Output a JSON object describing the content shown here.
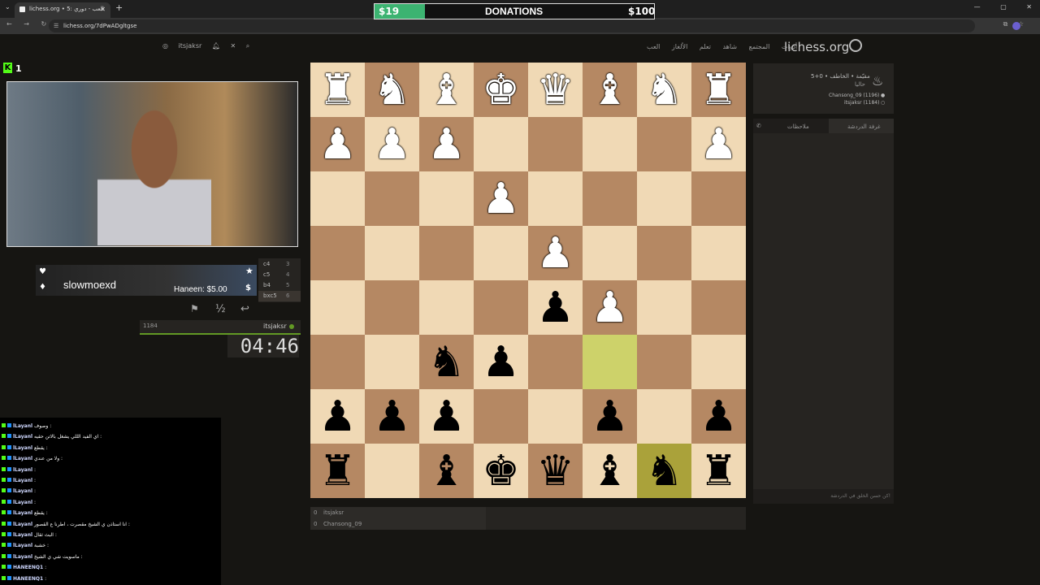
{
  "browser": {
    "tab_title": "lichess.org • العب - دوري :5",
    "url": "lichess.org/7dPwADgltgse",
    "tab_close": "✕",
    "new_tab": "+",
    "tab_list": "⌄",
    "window_controls": [
      "—",
      "▢",
      "✕"
    ],
    "nav": [
      "←",
      "→",
      "↻"
    ],
    "addr_icons": [
      "⧉",
      "☆"
    ],
    "site_icon": "☰"
  },
  "donations": {
    "low": "$19",
    "title": "DONATIONS",
    "high": "$100",
    "progress": 0.19
  },
  "header": {
    "logo": "lichess.org",
    "nav": [
      "أدوات",
      "المجتمع",
      "شاهد",
      "تعلم",
      "الألغاز",
      "العب"
    ],
    "username": "itsjaksr",
    "icons": [
      "user-icon",
      "bell-icon",
      "close-icon",
      "search-icon"
    ]
  },
  "stream": {
    "platform_badge": "K",
    "viewer_count": "1",
    "streamer_name": "slowmoexd",
    "latest_donation": "Haneen: $5.00",
    "heart": "♥",
    "drop": "♦",
    "star": "★",
    "dollar": "$"
  },
  "move_list": [
    {
      "move": "c4",
      "num": "3"
    },
    {
      "move": "c5",
      "num": "4"
    },
    {
      "move": "b4",
      "num": "5"
    },
    {
      "move": "bxc5",
      "num": "6"
    }
  ],
  "game_controls": {
    "resign": "⚑",
    "draw": "½",
    "takeback": "↩"
  },
  "self_player": {
    "rating": "1184",
    "name": "itsjaksr",
    "clock": "04:46"
  },
  "chat": [
    {
      "user": "lLayanl",
      "msg": "وصوف :"
    },
    {
      "user": "lLayanl",
      "msg": "اي الفيد الللي يشغل بالاتن حقيه :"
    },
    {
      "user": "lLayanl",
      "msg": "يقطع :"
    },
    {
      "user": "lLayanl",
      "msg": "ولا من عندي :"
    },
    {
      "user": "lLayanl",
      "msg": ":"
    },
    {
      "user": "lLayanl",
      "msg": ":"
    },
    {
      "user": "lLayanl",
      "msg": ":"
    },
    {
      "user": "lLayanl",
      "msg": ":"
    },
    {
      "user": "lLayanl",
      "msg": "يقطع :"
    },
    {
      "user": "lLayanl",
      "msg": "انا استاذن ي الشيخ مقصرت ، اطرنا ع القصور :"
    },
    {
      "user": "lLayanl",
      "msg": "البث ثقال :"
    },
    {
      "user": "lLayanl",
      "msg": "خشبة :"
    },
    {
      "user": "lLayanl",
      "msg": "ماسويت شي ي الشيخ :"
    },
    {
      "user": "HANEENQ1",
      "msg": ":"
    },
    {
      "user": "HANEENQ1",
      "msg": ":"
    }
  ],
  "board": {
    "light_color": "#f0d9b5",
    "dark_color": "#b58863",
    "highlight_light": "#cdd26a",
    "highlight_dark": "#aaa23a",
    "rows": [
      [
        "wR",
        "wN",
        "wB",
        "wK",
        "wQ",
        "wB",
        "wN",
        "wR"
      ],
      [
        "wP",
        "wP",
        "wP",
        "",
        "",
        "",
        "",
        "wP"
      ],
      [
        "",
        "",
        "",
        "wP",
        "",
        "",
        "",
        ""
      ],
      [
        "",
        "",
        "",
        "",
        "wP",
        "",
        "",
        ""
      ],
      [
        "",
        "",
        "",
        "",
        "bP",
        "wP",
        "",
        ""
      ],
      [
        "",
        "",
        "bN",
        "bP",
        "",
        "",
        "",
        ""
      ],
      [
        "bP",
        "bP",
        "bP",
        "",
        "",
        "bP",
        "",
        "bP"
      ],
      [
        "bR",
        "",
        "bB",
        "bK",
        "bQ",
        "bB",
        "bN",
        "bR"
      ]
    ],
    "highlights": [
      [
        5,
        5
      ],
      [
        7,
        6
      ]
    ]
  },
  "players": [
    {
      "score": "0",
      "name": "itsjaksr"
    },
    {
      "score": "0",
      "name": "Chansong_09"
    }
  ],
  "game_info": {
    "mode": "5+0 • مقيّمة • الخاطف",
    "time": "حاليا",
    "white": "Chansong_09 (1196)",
    "black": "itsjaksr (1184)",
    "white_marker": "●",
    "black_marker": "○"
  },
  "chat_panel": {
    "tab_room": "غرفة الدردشة",
    "tab_notes": "ملاحظات",
    "placeholder": "كن حسن الخلق في الدردشة!",
    "phone": "✆"
  }
}
